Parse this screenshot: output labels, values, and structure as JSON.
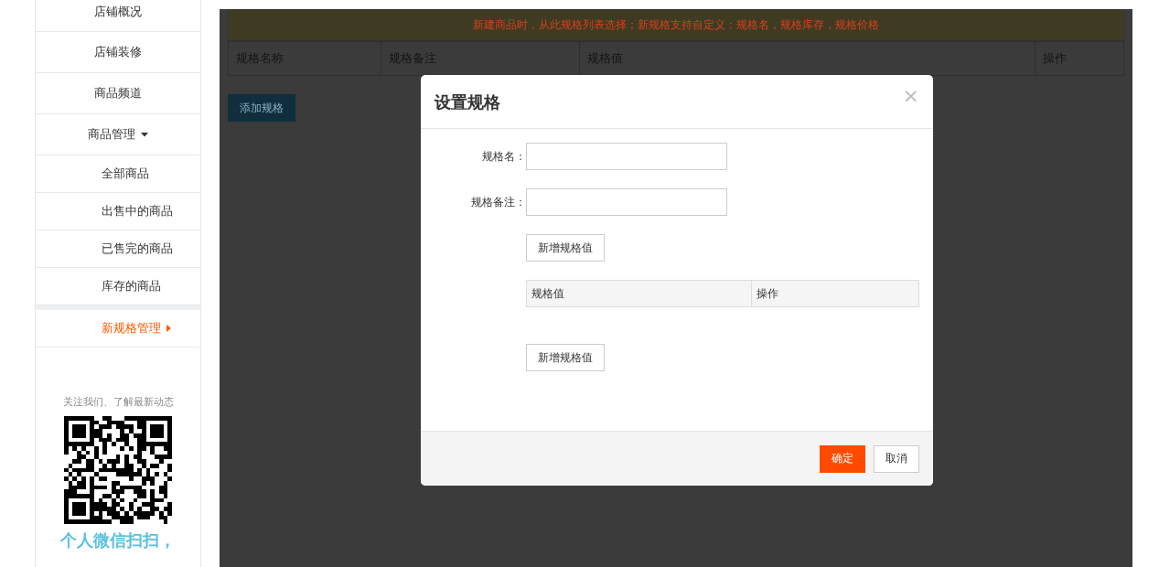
{
  "sidebar": {
    "items": [
      {
        "label": "店铺概况",
        "selected": false
      },
      {
        "label": "店铺装修",
        "selected": false
      },
      {
        "label": "商品频道",
        "selected": false
      },
      {
        "label": "商品管理",
        "selected": false,
        "expanded": true,
        "children": [
          {
            "label": "全部商品",
            "selected": false
          },
          {
            "label": "出售中的商品",
            "selected": false
          },
          {
            "label": "已售完的商品",
            "selected": false
          },
          {
            "label": "库存的商品",
            "selected": false
          },
          {
            "label": "新规格管理",
            "selected": true
          }
        ]
      }
    ],
    "follow_text": "关注我们、了解最新动态",
    "qr_caption": "个人微信扫扫，"
  },
  "page": {
    "notice": "新建商品时，从此规格列表选择；新规格支持自定义：规格名，规格库存，规格价格",
    "table": {
      "columns": [
        "规格名称",
        "规格备注",
        "规格值",
        "操作"
      ]
    },
    "add_button": "添加规格"
  },
  "dialog": {
    "title": "设置规格",
    "close": "×",
    "fields": [
      {
        "label": "规格名："
      },
      {
        "label": "规格备注："
      }
    ],
    "add_value_button": "新增规格值",
    "values_table": {
      "columns": [
        "规格值",
        "操作"
      ]
    },
    "add_value_button_2": "新增规格值",
    "buttons": [
      {
        "label": "确定",
        "kind": "primary"
      },
      {
        "label": "取消",
        "kind": "default"
      }
    ]
  }
}
